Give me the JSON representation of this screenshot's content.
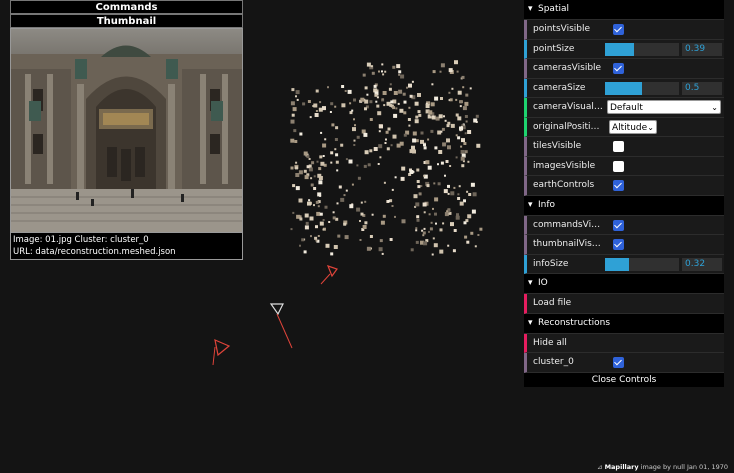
{
  "overlay": {
    "commands_title": "Commands",
    "thumbnail_title": "Thumbnail",
    "image_info": "Image: 01.jpg Cluster: cluster_0",
    "url_info": "URL: data/reconstruction.meshed.json"
  },
  "controls": {
    "spatial": {
      "title": "Spatial",
      "pointsVisible": "pointsVisible",
      "pointSize": "pointSize",
      "pointSize_value": "0.39",
      "pointSize_fraction": 0.39,
      "camerasVisible": "camerasVisible",
      "cameraSize": "cameraSize",
      "cameraSize_value": "0.5",
      "cameraSize_fraction": 0.5,
      "cameraVisualization": "cameraVisualizat...",
      "cameraVisualization_value": "Default",
      "originalPosition": "originalPosition...",
      "originalPosition_value": "Altitude",
      "tilesVisible": "tilesVisible",
      "imagesVisible": "imagesVisible",
      "earthControls": "earthControls"
    },
    "info": {
      "title": "Info",
      "commandsVisible": "commandsVisible",
      "thumbnailVisible": "thumbnailVisible",
      "infoSize": "infoSize",
      "infoSize_value": "0.32",
      "infoSize_fraction": 0.32
    },
    "io": {
      "title": "IO",
      "load_file": "Load file"
    },
    "reconstructions": {
      "title": "Reconstructions",
      "hide_all": "Hide all",
      "cluster_0": "cluster_0"
    },
    "close": "Close Controls"
  },
  "attribution": {
    "brand": "Mapillary",
    "text": "image by null  Jan 01, 1970"
  },
  "colors": {
    "background": "#141414",
    "accent_number": "#2fa1d6",
    "camera_selected": "#dddddd",
    "camera_other": "#e0443a"
  }
}
